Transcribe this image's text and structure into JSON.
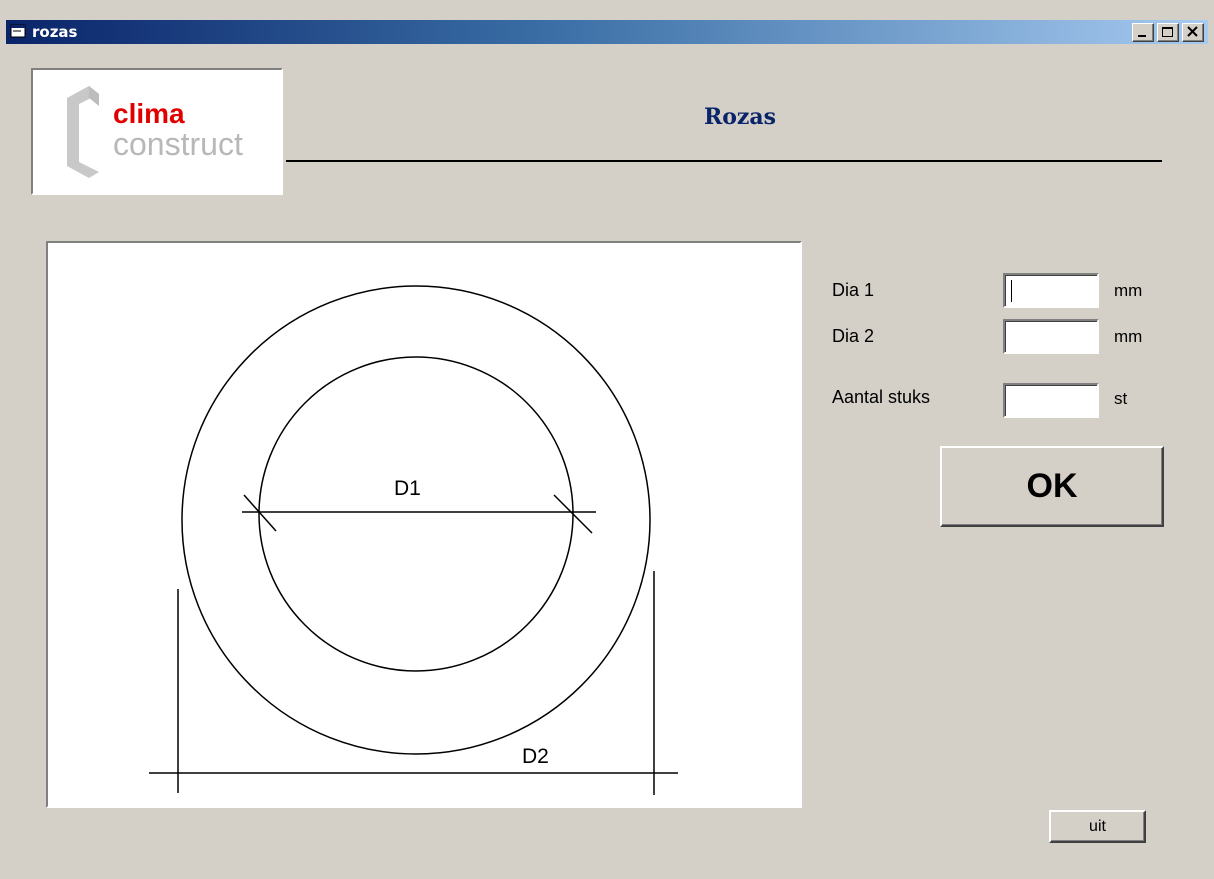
{
  "window": {
    "title": "rozas"
  },
  "logo": {
    "line1": "clima",
    "line2": "construct"
  },
  "heading": "Rozas",
  "drawing": {
    "inner_label": "D1",
    "outer_label": "D2"
  },
  "form": {
    "dia1": {
      "label": "Dia 1",
      "value": "",
      "unit": "mm"
    },
    "dia2": {
      "label": "Dia 2",
      "value": "",
      "unit": "mm"
    },
    "count": {
      "label": "Aantal stuks",
      "value": "",
      "unit": "st"
    }
  },
  "buttons": {
    "ok": "OK",
    "exit": "uit"
  }
}
